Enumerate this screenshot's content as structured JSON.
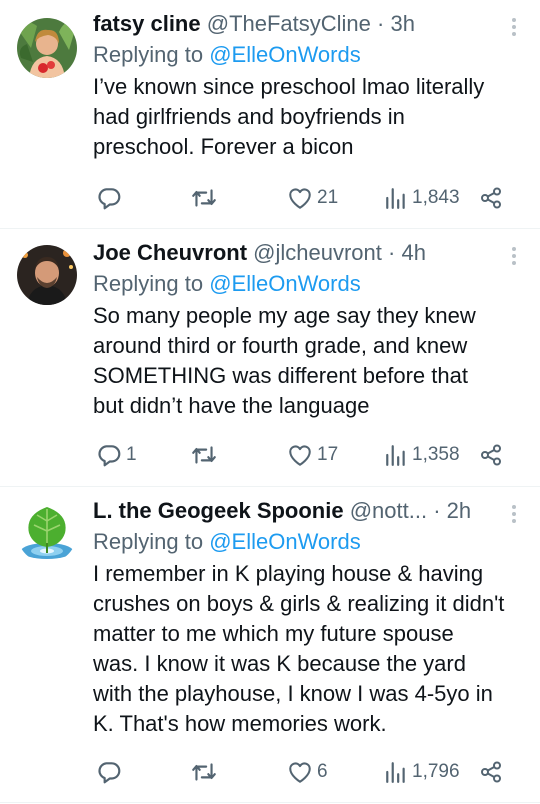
{
  "tweets": [
    {
      "name": "fatsy cline",
      "handle": "@TheFatsyCline",
      "separator": "·",
      "time": "3h",
      "replying_prefix": "Replying to",
      "replying_to": "@ElleOnWords",
      "lines": [
        "I’ve known since preschool lmao literally",
        "had girlfriends and boyfriends in",
        "preschool. Forever a bicon"
      ],
      "replies": "",
      "retweets": "",
      "likes": "21",
      "views": "1,843",
      "avatar_icon": "woman-with-plants-avatar"
    },
    {
      "name": "Joe Cheuvront",
      "handle": "@jlcheuvront",
      "separator": "·",
      "time": "4h",
      "replying_prefix": "Replying to",
      "replying_to": "@ElleOnWords",
      "lines": [
        "So many people my age say they knew",
        "around third or fourth grade, and knew",
        "SOMETHING was different before that",
        "but didn’t have the language"
      ],
      "replies": "1",
      "retweets": "",
      "likes": "17",
      "views": "1,358",
      "avatar_icon": "man-selfie-avatar"
    },
    {
      "name": "L. the Geogeek Spoonie",
      "handle": "@nott...",
      "separator": "·",
      "time": "2h",
      "replying_prefix": "Replying to",
      "replying_to": "@ElleOnWords",
      "lines": [
        "I remember in K playing house & having",
        "crushes on boys & girls & realizing it didn't",
        "matter to me which my future spouse",
        "was. I know it was K because the yard",
        "with the playhouse, I know I was 4-5yo in",
        "K. That's how memories work."
      ],
      "replies": "",
      "retweets": "",
      "likes": "6",
      "views": "1,796",
      "avatar_icon": "leaf-water-drop-avatar"
    }
  ],
  "icons": {
    "reply": "reply-icon",
    "retweet": "retweet-icon",
    "like": "heart-icon",
    "views": "views-bar-icon",
    "share": "share-icon",
    "more": "more-vertical-icon"
  },
  "colors": {
    "text": "#0f1419",
    "secondary": "#536471",
    "link": "#1d9bf0",
    "divider": "#eff3f4"
  }
}
